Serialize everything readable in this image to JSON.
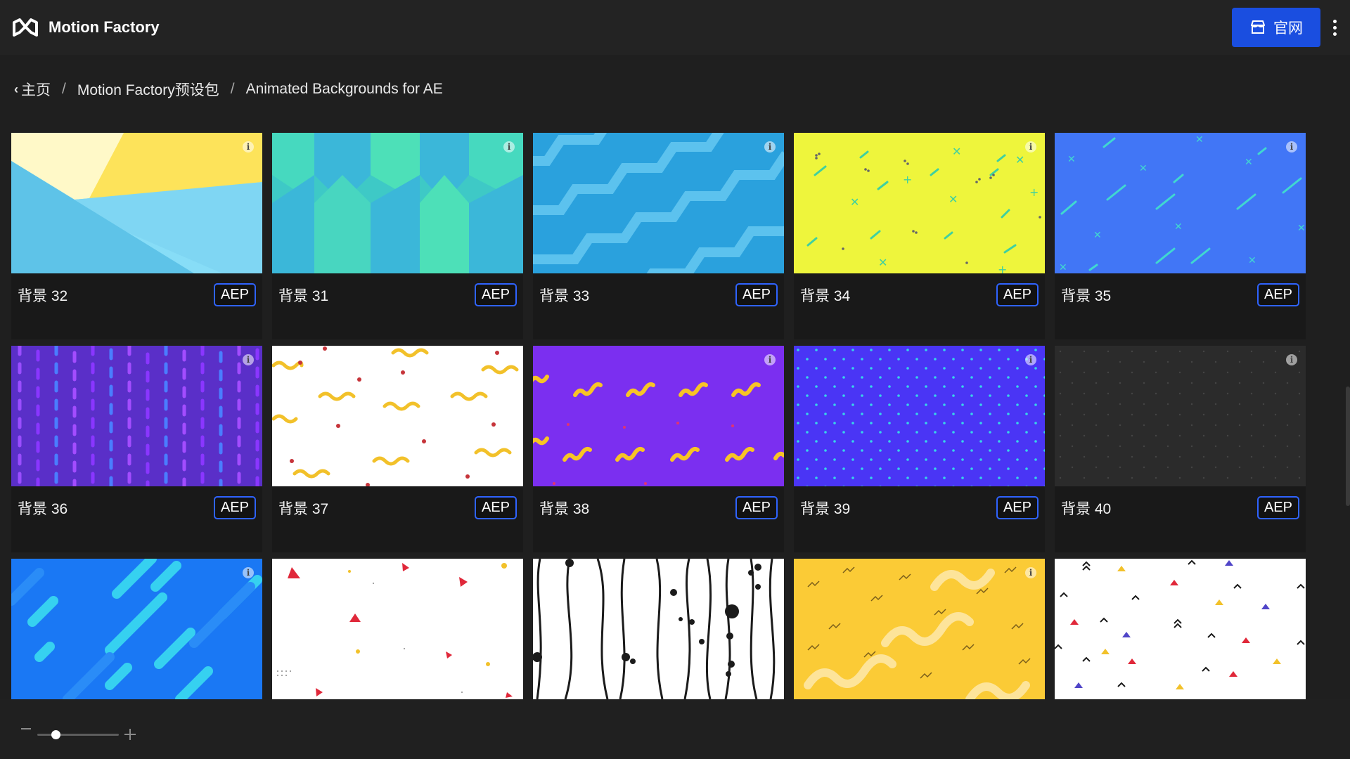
{
  "app": {
    "title": "Motion Factory",
    "site_button_label": "官网"
  },
  "breadcrumb": {
    "home": "主页",
    "pack": "Motion Factory预设包",
    "current": "Animated Backgrounds for AE"
  },
  "colors": {
    "accent": "#1a4ee0",
    "badge_border": "#2f63ff",
    "background": "#1f1f1f"
  },
  "cards": [
    {
      "title": "背景 32",
      "badge": "AEP"
    },
    {
      "title": "背景 31",
      "badge": "AEP"
    },
    {
      "title": "背景 33",
      "badge": "AEP"
    },
    {
      "title": "背景 34",
      "badge": "AEP"
    },
    {
      "title": "背景 35",
      "badge": "AEP"
    },
    {
      "title": "背景 36",
      "badge": "AEP"
    },
    {
      "title": "背景 37",
      "badge": "AEP"
    },
    {
      "title": "背景 38",
      "badge": "AEP"
    },
    {
      "title": "背景 39",
      "badge": "AEP"
    },
    {
      "title": "背景 40",
      "badge": "AEP"
    },
    {
      "title": "",
      "badge": ""
    },
    {
      "title": "",
      "badge": ""
    },
    {
      "title": "",
      "badge": ""
    },
    {
      "title": "",
      "badge": ""
    },
    {
      "title": "",
      "badge": ""
    }
  ],
  "icons": {
    "logo": "motion-factory-logo-icon",
    "store": "store-icon",
    "more": "more-vertical-icon",
    "back": "chevron-left-icon",
    "info": "info-icon"
  },
  "zoom": {
    "level_fraction": 0.18
  }
}
